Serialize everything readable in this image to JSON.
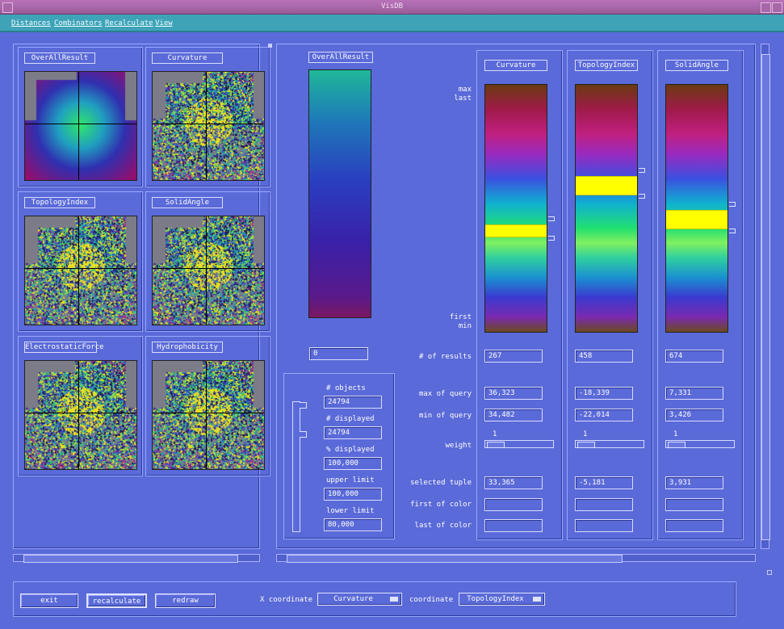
{
  "window": {
    "title": "VisDB"
  },
  "menu": [
    "Distances",
    "Combinators",
    "Recalculate",
    "View"
  ],
  "thumbs": [
    {
      "label": "OverAllResult",
      "kind": "overall"
    },
    {
      "label": "Curvature",
      "kind": "noise"
    },
    {
      "label": "TopologyIndex",
      "kind": "noise"
    },
    {
      "label": "SolidAngle",
      "kind": "noise"
    },
    {
      "label": "ElectrostaticForce",
      "kind": "noise"
    },
    {
      "label": "Hydrophobicity",
      "kind": "noise"
    }
  ],
  "overall": {
    "label": "OverAllResult",
    "value": "0"
  },
  "stats": {
    "objects_label": "# objects",
    "objects": "24794",
    "displayed_label": "# displayed",
    "displayed": "24794",
    "pct_label": "% displayed",
    "pct": "100,000",
    "upper_label": "upper limit",
    "upper": "100,000",
    "lower_label": "lower limit",
    "lower": "80,000"
  },
  "scale_labels": {
    "max": "max",
    "last": "last",
    "first": "first",
    "min": "min"
  },
  "row_labels": {
    "results": "# of results",
    "maxq": "max of query",
    "minq": "min of query",
    "weight": "weight",
    "tuple": "selected tuple",
    "firstc": "first of color",
    "lastc": "last of color"
  },
  "attributes": [
    {
      "name": "Curvature",
      "results": "267",
      "maxq": "36,323",
      "minq": "34,482",
      "weight": "1",
      "tuple": "33,365",
      "firstc": "",
      "lastc": "",
      "band_top": 0.565,
      "band_height": 0.045
    },
    {
      "name": "TopologyIndex",
      "results": "458",
      "maxq": "-18,339",
      "minq": "-22,014",
      "weight": "1",
      "tuple": "-5,181",
      "firstc": "",
      "lastc": "",
      "band_top": 0.37,
      "band_height": 0.07
    },
    {
      "name": "SolidAngle",
      "results": "674",
      "maxq": "7,331",
      "minq": "3,426",
      "weight": "1",
      "tuple": "3,931",
      "firstc": "",
      "lastc": "",
      "band_top": 0.505,
      "band_height": 0.075
    }
  ],
  "bottom": {
    "exit": "exit",
    "recalculate": "recalculate",
    "redraw": "redraw",
    "xcoord_label": "X coordinate :",
    "xcoord": "Curvature",
    "ycoord_label": "coordinate :",
    "ycoord": "TopologyIndex"
  }
}
